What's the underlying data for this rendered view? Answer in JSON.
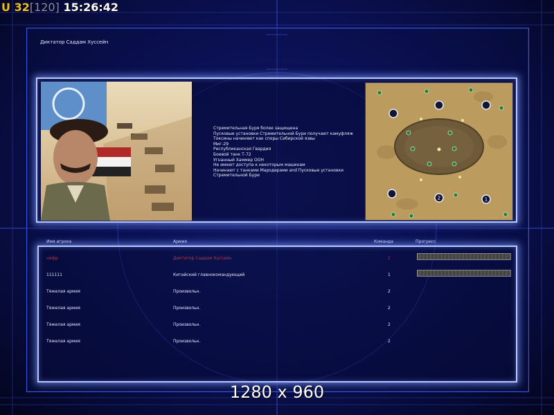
{
  "hud": {
    "unit_label": "U",
    "unit_count": "32",
    "ping": "[120]",
    "clock": "15:26:42"
  },
  "screen": {
    "title": "Диктатор Саддам Хуссейн"
  },
  "briefing": {
    "lines": [
      "Стремительная Буря более защищена",
      "Пусковые установки Стремительной Бури получают камуфляж",
      "Токсины начиняют как споры Сибирской язвы",
      "Миг-29",
      "Республиканская Гвардия",
      "Боевой танк Т-72",
      "Угнанный Хаммер ООН",
      "Не имеют доступа к некоторым машинам",
      "Начинают с танками Мародерами and Пусковые установки",
      " Стремительной Бури"
    ]
  },
  "players": {
    "headers": {
      "name": "Имя игрока",
      "army": "Армия",
      "team": "Команда",
      "progress": "Прогресс"
    },
    "rows": [
      {
        "name": "нифр",
        "army": "Диктатор Саддам Хуссейн",
        "team": "1",
        "progress": 1.0
      },
      {
        "name": "111111",
        "army": "Китайский главнокомандующий",
        "team": "1",
        "progress": 1.0
      },
      {
        "name": "Тяжелая армия",
        "army": "Произвольн.",
        "team": "2"
      },
      {
        "name": "Тяжелая армия",
        "army": "Произвольн.",
        "team": "2"
      },
      {
        "name": "Тяжелая армия",
        "army": "Произвольн.",
        "team": "2"
      },
      {
        "name": "Тяжелая армия",
        "army": "Произвольн.",
        "team": "2"
      }
    ]
  },
  "map": {
    "start_markers": [
      "",
      "",
      "",
      "",
      "2",
      "1"
    ]
  },
  "overlay": {
    "resolution": "1280 x 960"
  },
  "colors": {
    "background": "#0c125a",
    "panel_glow": "#b9c7ff",
    "active_player": "#e02a2a",
    "hud_unit": "#f0c020"
  }
}
